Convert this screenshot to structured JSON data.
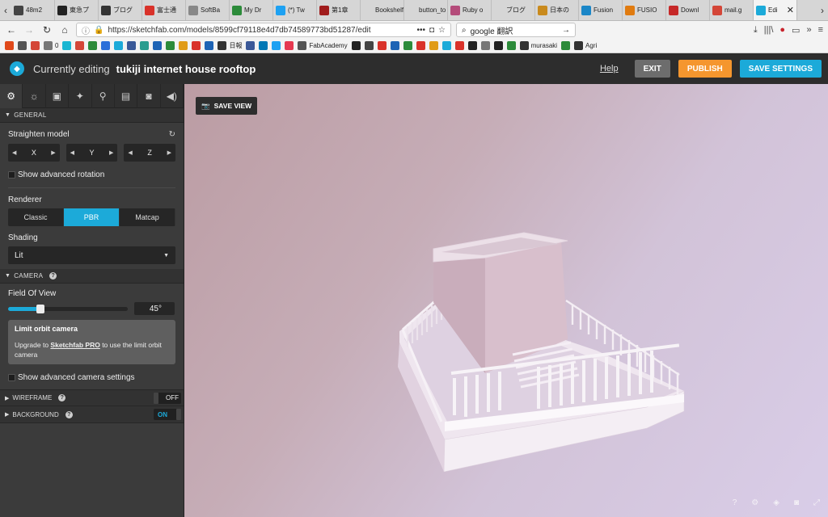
{
  "browser": {
    "tabs": [
      {
        "label": "48m2",
        "color": "#444444"
      },
      {
        "label": "東急プ",
        "color": "#222222"
      },
      {
        "label": "ブログ",
        "color": "#333333"
      },
      {
        "label": "富士通",
        "color": "#d9322a"
      },
      {
        "label": "SoftBa",
        "color": "#888888"
      },
      {
        "label": "My Dr",
        "color": "#2c8b3a"
      },
      {
        "label": "(*) Tw",
        "color": "#1da1f2"
      },
      {
        "label": "第1章",
        "color": "#a01c1c"
      },
      {
        "label": "Bookshelf",
        "color": "#d6d6d6"
      },
      {
        "label": "button_to",
        "color": "#d6d6d6"
      },
      {
        "label": "Ruby o",
        "color": "#b44b7a"
      },
      {
        "label": "ブログ",
        "color": "#d6d6d6"
      },
      {
        "label": "日本の",
        "color": "#c98a1d"
      },
      {
        "label": "Fusion",
        "color": "#1a86c7"
      },
      {
        "label": "FUSIO",
        "color": "#e07b10"
      },
      {
        "label": "Downl",
        "color": "#c62828"
      },
      {
        "label": "mail.g",
        "color": "#d44638"
      },
      {
        "label": "Edi",
        "color": "#1caad9"
      }
    ],
    "url": "https://sketchfab.com/models/8599cf79118e4d7db74589773bd51287/edit",
    "search_value": "google 翻訳",
    "bookmarks": [
      {
        "label": "",
        "color": "#e0491a"
      },
      {
        "label": "",
        "color": "#555555"
      },
      {
        "label": "",
        "color": "#d44638"
      },
      {
        "label": "0",
        "color": "#777777"
      },
      {
        "label": "",
        "color": "#19b6d2"
      },
      {
        "label": "",
        "color": "#d44638"
      },
      {
        "label": "",
        "color": "#2c8b3a"
      },
      {
        "label": "",
        "color": "#2c6fd9"
      },
      {
        "label": "",
        "color": "#1caad9"
      },
      {
        "label": "",
        "color": "#3a5998"
      },
      {
        "label": "",
        "color": "#2a9d8f"
      },
      {
        "label": "",
        "color": "#1d63b5"
      },
      {
        "label": "",
        "color": "#2c8b3a"
      },
      {
        "label": "",
        "color": "#e09b17"
      },
      {
        "label": "",
        "color": "#d9322a"
      },
      {
        "label": "",
        "color": "#1d63b5"
      },
      {
        "label": "日報",
        "color": "#333333"
      },
      {
        "label": "",
        "color": "#3b5998"
      },
      {
        "label": "",
        "color": "#0077b5"
      },
      {
        "label": "",
        "color": "#1da1f2"
      },
      {
        "label": "",
        "color": "#e63950"
      },
      {
        "label": "FabAcademy",
        "color": "#555555"
      },
      {
        "label": "",
        "color": "#222222"
      },
      {
        "label": "",
        "color": "#444444"
      },
      {
        "label": "",
        "color": "#d9322a"
      },
      {
        "label": "",
        "color": "#1d63b5"
      },
      {
        "label": "",
        "color": "#2c8b3a"
      },
      {
        "label": "",
        "color": "#d9322a"
      },
      {
        "label": "",
        "color": "#e09b17"
      },
      {
        "label": "",
        "color": "#1caad9"
      },
      {
        "label": "",
        "color": "#d9322a"
      },
      {
        "label": "",
        "color": "#222222"
      },
      {
        "label": "",
        "color": "#777777"
      },
      {
        "label": "",
        "color": "#222222"
      },
      {
        "label": "",
        "color": "#2c8b3a"
      },
      {
        "label": "murasaki",
        "color": "#333333"
      },
      {
        "label": "",
        "color": "#2c8b3a"
      },
      {
        "label": "Agri",
        "color": "#333333"
      }
    ]
  },
  "header": {
    "editing_label": "Currently editing",
    "model_name": "tukiji internet house rooftop",
    "help_label": "Help",
    "exit_label": "EXIT",
    "publish_label": "PUBLISH",
    "save_label": "SAVE SETTINGS"
  },
  "sidebar": {
    "tabs": [
      "gear-icon",
      "light-icon",
      "image-icon",
      "wand-icon",
      "pin-icon",
      "film-icon",
      "vr-icon",
      "sound-icon"
    ],
    "general": {
      "title": "GENERAL",
      "straighten_label": "Straighten model",
      "axes": [
        "X",
        "Y",
        "Z"
      ],
      "advanced_rotation_label": "Show advanced rotation",
      "renderer_label": "Renderer",
      "renderer_options": [
        "Classic",
        "PBR",
        "Matcap"
      ],
      "renderer_selected": "PBR",
      "shading_label": "Shading",
      "shading_value": "Lit"
    },
    "camera": {
      "title": "CAMERA",
      "fov_label": "Field Of View",
      "fov_value": "45°",
      "fov_fraction": 0.27,
      "promo_title": "Limit orbit camera",
      "promo_text_before": "Upgrade to ",
      "promo_link": "Sketchfab PRO",
      "promo_text_after": " to use the limit orbit camera",
      "advanced_camera_label": "Show advanced camera settings"
    },
    "wireframe": {
      "title": "WIREFRAME",
      "state": "OFF"
    },
    "background": {
      "title": "BACKGROUND",
      "state": "ON"
    }
  },
  "viewport": {
    "save_view_label": "SAVE VIEW",
    "icons": [
      "help-icon",
      "settings-icon",
      "layers-icon",
      "vr-icon",
      "fullscreen-icon"
    ]
  },
  "colors": {
    "accent": "#1caad9",
    "publish": "#f5962e",
    "exit": "#6d6d6d",
    "header_bg": "#2d2d2d"
  }
}
